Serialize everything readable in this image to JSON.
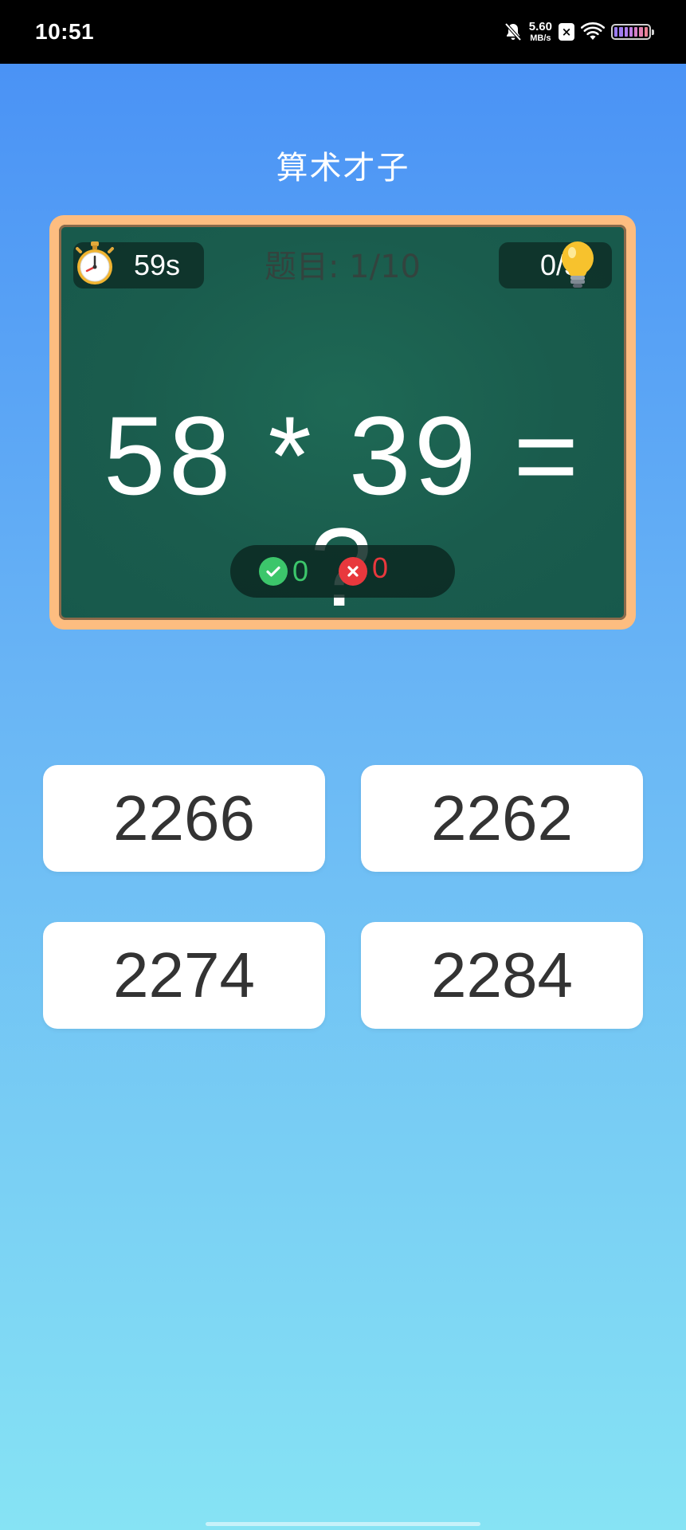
{
  "status_bar": {
    "time": "10:51",
    "net_speed_value": "5.60",
    "net_speed_unit": "MB/s",
    "sim_badge": "×",
    "icons": [
      "mute-bell-icon",
      "sim-x-icon",
      "wifi-icon",
      "battery-icon"
    ]
  },
  "app": {
    "title": "算术才子"
  },
  "board": {
    "timer": "59s",
    "question_counter": "题目: 1/10",
    "hints": "0/5",
    "equation": "58 * 39 = ?",
    "correct_count": "0",
    "wrong_count": "0"
  },
  "options": [
    "2266",
    "2262",
    "2274",
    "2284"
  ],
  "colors": {
    "background_top": "#478ff5",
    "background_bottom": "#86e3f4",
    "board_green": "#1a5c4d",
    "board_frame": "#fdbd80",
    "correct_green": "#3cc66b",
    "wrong_red": "#e8383d"
  }
}
